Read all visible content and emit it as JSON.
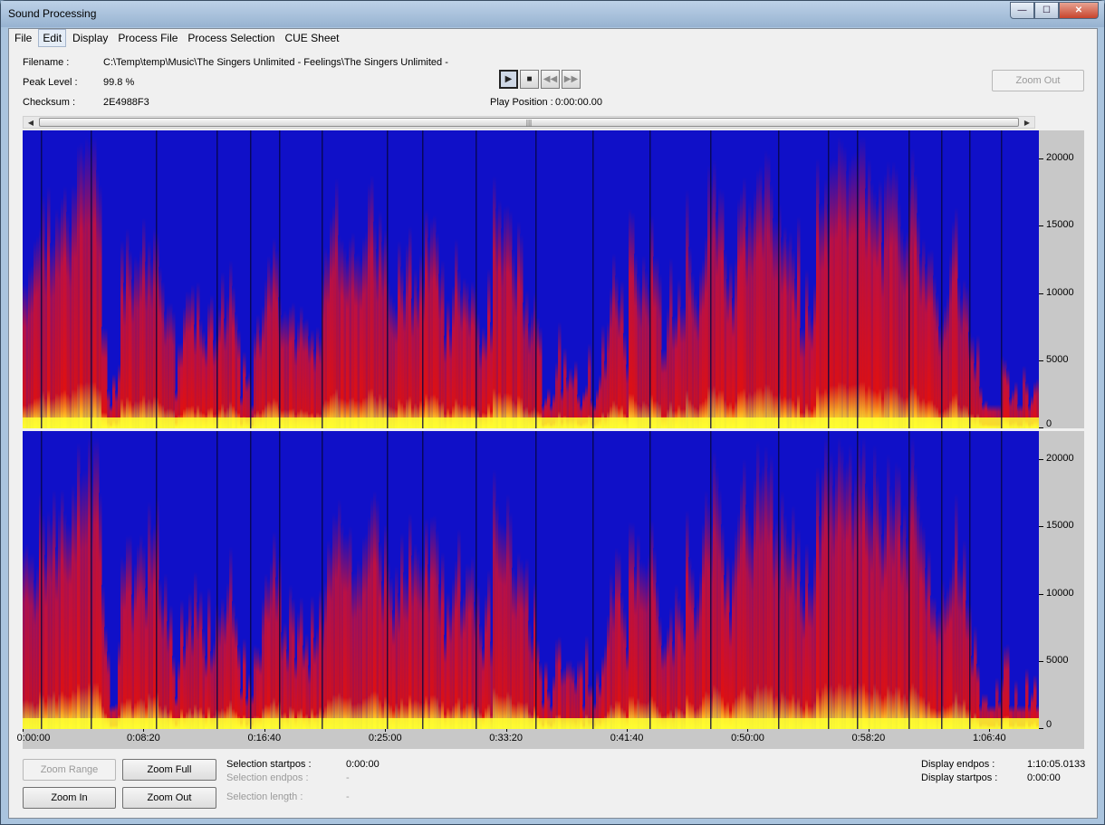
{
  "window": {
    "title": "Sound Processing"
  },
  "window_controls": {
    "minimize": "—",
    "maximize": "☐",
    "close": "✕"
  },
  "menu": {
    "items": [
      "File",
      "Edit",
      "Display",
      "Process File",
      "Process Selection",
      "CUE Sheet"
    ],
    "active_index": 1
  },
  "info": {
    "filename_label": "Filename :",
    "filename_value": "C:\\Temp\\temp\\Music\\The Singers Unlimited - Feelings\\The Singers Unlimited -",
    "peak_label": "Peak Level :",
    "peak_value": "99.8 %",
    "checksum_label": "Checksum :",
    "checksum_value": "2E4988F3",
    "play_position_label": "Play Position :",
    "play_position_value": "0:00:00.00"
  },
  "transport": {
    "play": "▶",
    "stop": "■",
    "rewind": "◀◀",
    "forward": "▶▶"
  },
  "buttons": {
    "zoom_out_top": "Zoom Out",
    "zoom_range": "Zoom Range",
    "zoom_full": "Zoom Full",
    "zoom_in": "Zoom In",
    "zoom_out": "Zoom Out"
  },
  "scrollbar": {
    "left": "◀",
    "right": "▶",
    "grip": "|||"
  },
  "spectrogram": {
    "y_ticks": [
      "20000",
      "15000",
      "10000",
      "5000",
      "0"
    ],
    "y_tick_values": [
      20000,
      15000,
      10000,
      5000,
      0
    ],
    "y_max": 22050,
    "x_ticks": [
      "0:00:00",
      "0:08:20",
      "0:16:40",
      "0:25:00",
      "0:33:20",
      "0:41:40",
      "0:50:00",
      "0:58:20",
      "1:06:40"
    ],
    "x_tick_seconds": [
      0,
      500,
      1000,
      1500,
      2000,
      2500,
      3000,
      3500,
      4000
    ],
    "duration_seconds": 4205.0133,
    "channels": 2,
    "colors": {
      "low": "#1010c8",
      "mid": "#e01010",
      "high": "#ffff30"
    }
  },
  "selection": {
    "startpos_label": "Selection startpos :",
    "startpos_value": "0:00:00",
    "endpos_label": "Selection endpos :",
    "endpos_value": "-",
    "length_label": "Selection length :",
    "length_value": "-"
  },
  "display": {
    "endpos_label": "Display endpos :",
    "endpos_value": "1:10:05.0133",
    "startpos_label": "Display startpos :",
    "startpos_value": "0:00:00"
  }
}
